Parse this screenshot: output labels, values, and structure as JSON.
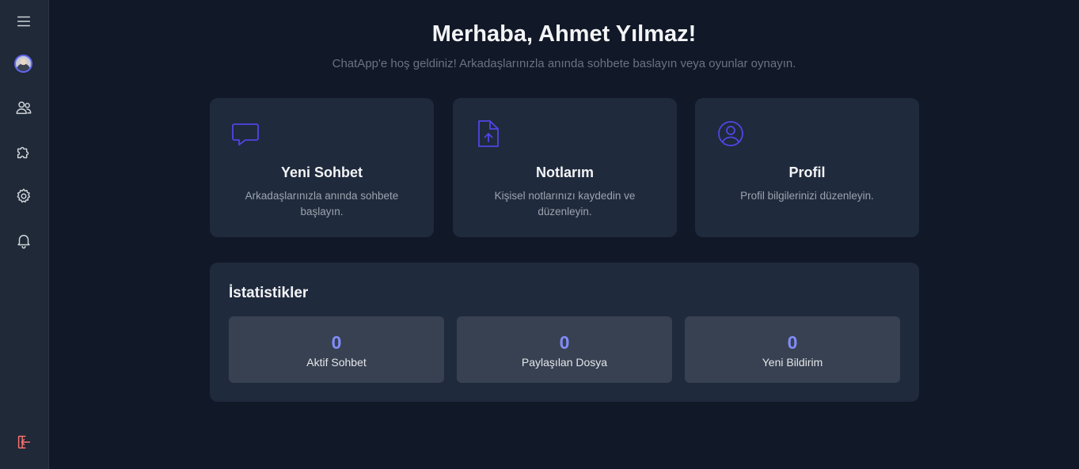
{
  "header": {
    "greeting": "Merhaba, Ahmet Yılmaz!",
    "subtitle": "ChatApp'e hoş geldiniz! Arkadaşlarınızla anında sohbete baslayın veya oyunlar oynayın."
  },
  "sidebar": {
    "items": [
      {
        "icon": "menu-icon"
      },
      {
        "icon": "avatar"
      },
      {
        "icon": "users-icon"
      },
      {
        "icon": "puzzle-icon"
      },
      {
        "icon": "settings-icon"
      },
      {
        "icon": "bell-icon"
      },
      {
        "icon": "logout-icon"
      }
    ]
  },
  "cards": [
    {
      "icon": "chat-bubble-icon",
      "title": "Yeni Sohbet",
      "description": "Arkadaşlarınızla anında sohbete başlayın."
    },
    {
      "icon": "file-upload-icon",
      "title": "Notlarım",
      "description": "Kişisel notlarınızı kaydedin ve düzenleyin."
    },
    {
      "icon": "user-circle-icon",
      "title": "Profil",
      "description": "Profil bilgilerinizi düzenleyin."
    }
  ],
  "stats": {
    "title": "İstatistikler",
    "items": [
      {
        "value": "0",
        "label": "Aktif Sohbet"
      },
      {
        "value": "0",
        "label": "Paylaşılan Dosya"
      },
      {
        "value": "0",
        "label": "Yeni Bildirim"
      }
    ]
  },
  "colors": {
    "accent": "#4f46e5",
    "stat_number": "#818cf8",
    "background": "#111827",
    "card": "#1f2a3c",
    "logout": "#f87171"
  }
}
